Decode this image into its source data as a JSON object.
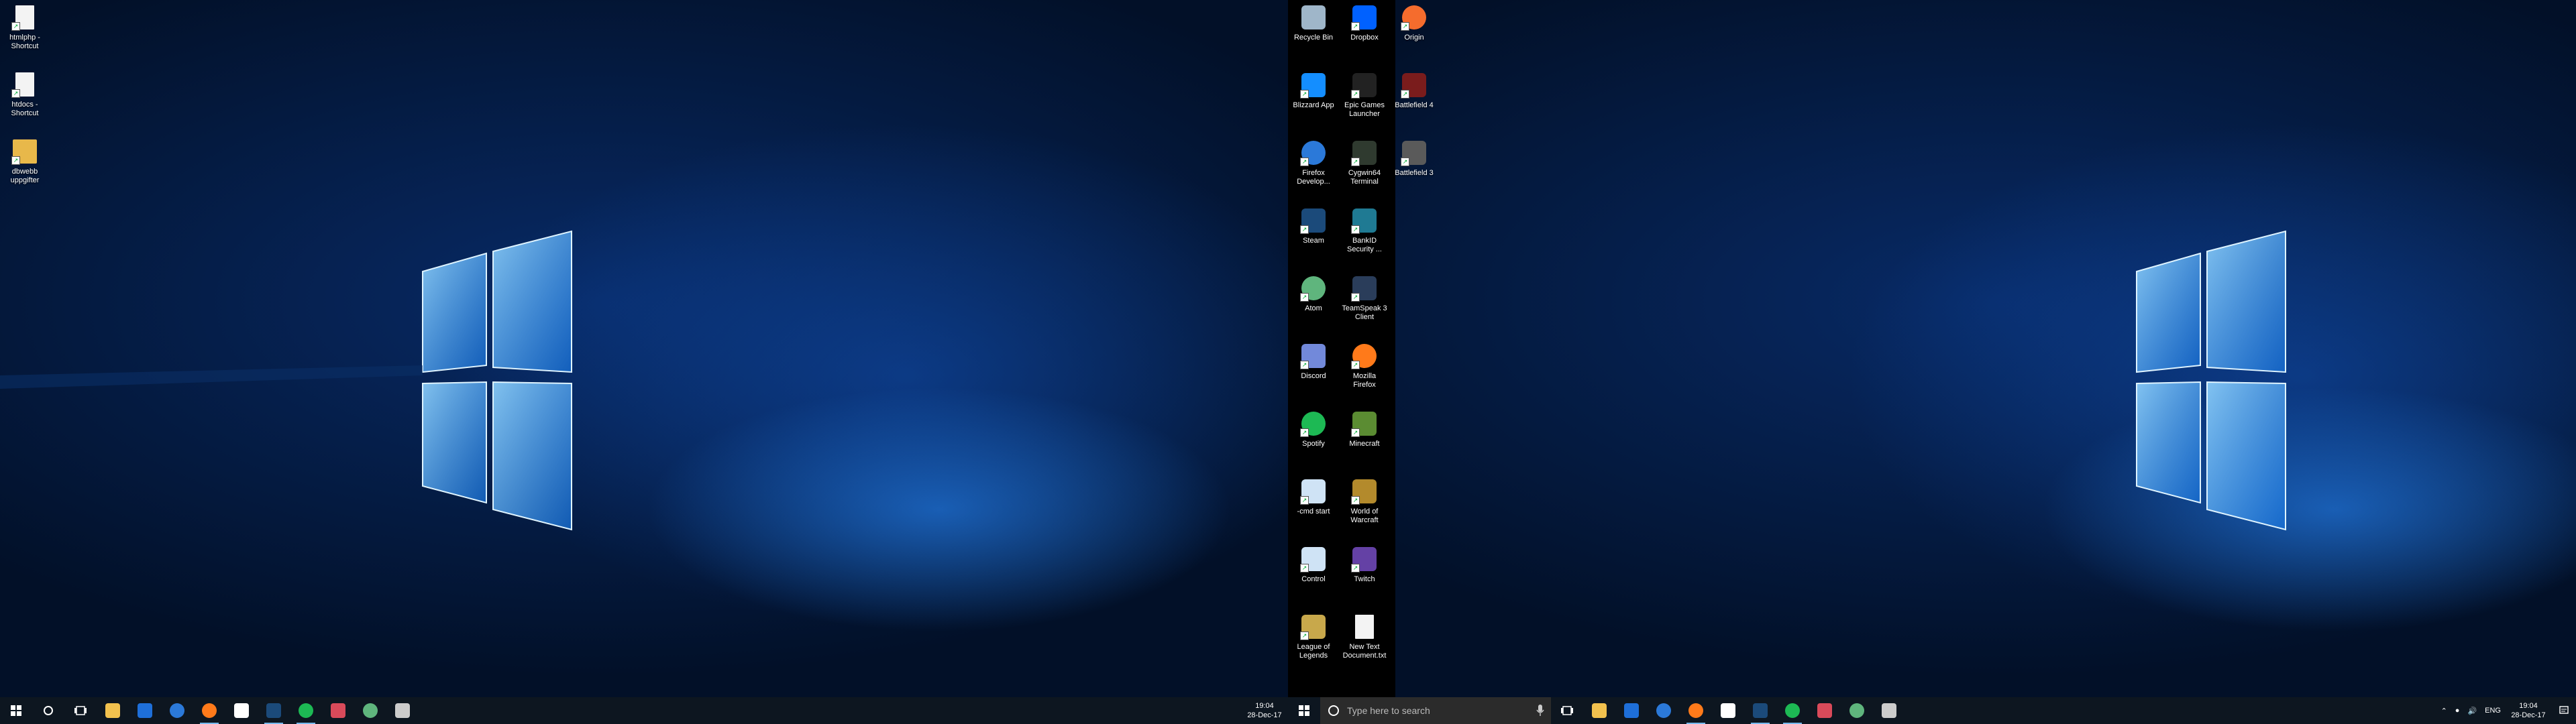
{
  "left_desktop_icons": [
    {
      "label": "htmlphp - Shortcut",
      "icon": "file-shortcut-icon",
      "color": "#f3f3f3"
    },
    {
      "label": "htdocs - Shortcut",
      "icon": "file-shortcut-icon",
      "color": "#f3f3f3"
    },
    {
      "label": "dbwebb uppgifter",
      "icon": "folder-icon",
      "color": "#e8b84a"
    }
  ],
  "center_desktop_icons": [
    {
      "label": "Recycle Bin",
      "icon": "recycle-bin-icon",
      "color": "#9fb6c9"
    },
    {
      "label": "Dropbox",
      "icon": "dropbox-icon",
      "color": "#0061ff"
    },
    {
      "label": "Origin",
      "icon": "origin-icon",
      "color": "#f56c2d"
    },
    {
      "label": "Blizzard App",
      "icon": "blizzard-icon",
      "color": "#148eff"
    },
    {
      "label": "Epic Games Launcher",
      "icon": "epic-games-icon",
      "color": "#222222"
    },
    {
      "label": "Battlefield 4",
      "icon": "battlefield-4-icon",
      "color": "#7a1c1c"
    },
    {
      "label": "Firefox Develop...",
      "icon": "firefox-developer-icon",
      "color": "#2b79d9"
    },
    {
      "label": "Cygwin64 Terminal",
      "icon": "terminal-icon",
      "color": "#2f3a2f"
    },
    {
      "label": "Battlefield 3",
      "icon": "battlefield-3-icon",
      "color": "#5a5a5a"
    },
    {
      "label": "Steam",
      "icon": "steam-icon",
      "color": "#1b4a7a"
    },
    {
      "label": "BankID Security ...",
      "icon": "bankid-icon",
      "color": "#1f7a93"
    },
    {
      "label": "Atom",
      "icon": "atom-icon",
      "color": "#5fb57d"
    },
    {
      "label": "TeamSpeak 3 Client",
      "icon": "teamspeak-icon",
      "color": "#2a3d5a"
    },
    {
      "label": "Discord",
      "icon": "discord-icon",
      "color": "#7289da"
    },
    {
      "label": "Mozilla Firefox",
      "icon": "firefox-icon",
      "color": "#ff7a1a"
    },
    {
      "label": "Spotify",
      "icon": "spotify-icon",
      "color": "#1db954"
    },
    {
      "label": "Minecraft",
      "icon": "minecraft-icon",
      "color": "#5b8c32"
    },
    {
      "label": "-cmd start",
      "icon": "window-shortcut-icon",
      "color": "#cfe3f5"
    },
    {
      "label": "World of Warcraft",
      "icon": "wow-icon",
      "color": "#b38a2c"
    },
    {
      "label": "Control",
      "icon": "window-shortcut-icon",
      "color": "#cfe3f5"
    },
    {
      "label": "Twitch",
      "icon": "twitch-icon",
      "color": "#6441a5"
    },
    {
      "label": "League of Legends",
      "icon": "league-icon",
      "color": "#c8a84b"
    },
    {
      "label": "New Text Document.txt",
      "icon": "text-document-icon",
      "color": "#f3f3f3"
    }
  ],
  "taskbar_left": {
    "apps": [
      {
        "name": "file-explorer-icon",
        "color": "#f2c14e",
        "running": false
      },
      {
        "name": "store-icon",
        "color": "#1e6fd9",
        "running": false
      },
      {
        "name": "firefox-developer-icon",
        "color": "#2b79d9",
        "running": false
      },
      {
        "name": "firefox-icon",
        "color": "#ff7a1a",
        "running": true
      },
      {
        "name": "mail-icon",
        "color": "#ffffff",
        "running": false
      },
      {
        "name": "steam-icon",
        "color": "#1b4a7a",
        "running": true
      },
      {
        "name": "spotify-icon",
        "color": "#1db954",
        "running": true
      },
      {
        "name": "snipping-tool-icon",
        "color": "#d94a5a",
        "running": false
      },
      {
        "name": "atom-icon",
        "color": "#5fb57d",
        "running": false
      },
      {
        "name": "cmd-icon",
        "color": "#cccccc",
        "running": false
      }
    ],
    "clock_time": "19:04",
    "clock_date": "28-Dec-17"
  },
  "taskbar_main": {
    "search_placeholder": "Type here to search",
    "apps": [
      {
        "name": "file-explorer-icon",
        "color": "#f2c14e",
        "running": false
      },
      {
        "name": "store-icon",
        "color": "#1e6fd9",
        "running": false
      },
      {
        "name": "firefox-developer-icon",
        "color": "#2b79d9",
        "running": false
      },
      {
        "name": "firefox-icon",
        "color": "#ff7a1a",
        "running": true
      },
      {
        "name": "mail-icon",
        "color": "#ffffff",
        "running": false
      },
      {
        "name": "steam-icon",
        "color": "#1b4a7a",
        "running": true
      },
      {
        "name": "spotify-icon",
        "color": "#1db954",
        "running": true
      },
      {
        "name": "snipping-tool-icon",
        "color": "#d94a5a",
        "running": false
      },
      {
        "name": "atom-icon",
        "color": "#5fb57d",
        "running": false
      },
      {
        "name": "cmd-icon",
        "color": "#cccccc",
        "running": false
      }
    ],
    "tray_language": "ENG",
    "clock_time": "19:04",
    "clock_date": "28-Dec-17"
  }
}
